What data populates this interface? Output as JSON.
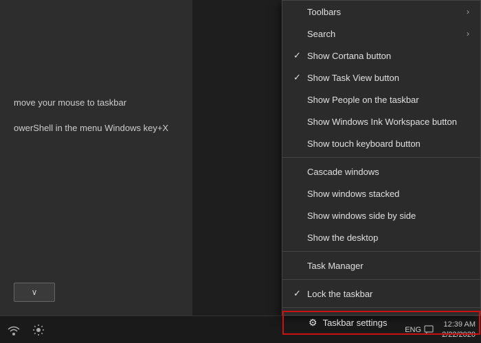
{
  "leftPanel": {
    "text1": "move your mouse to taskbar",
    "text2": "owerShell in the menu Windows key+X"
  },
  "contextMenu": {
    "items": [
      {
        "id": "toolbars",
        "label": "Toolbars",
        "check": "",
        "hasArrow": true,
        "separator_after": false
      },
      {
        "id": "search",
        "label": "Search",
        "check": "",
        "hasArrow": true,
        "separator_after": false
      },
      {
        "id": "show-cortana",
        "label": "Show Cortana button",
        "check": "✓",
        "hasArrow": false,
        "separator_after": false
      },
      {
        "id": "show-task-view",
        "label": "Show Task View button",
        "check": "✓",
        "hasArrow": false,
        "separator_after": false
      },
      {
        "id": "show-people",
        "label": "Show People on the taskbar",
        "check": "",
        "hasArrow": false,
        "separator_after": false
      },
      {
        "id": "show-ink",
        "label": "Show Windows Ink Workspace button",
        "check": "",
        "hasArrow": false,
        "separator_after": false
      },
      {
        "id": "show-keyboard",
        "label": "Show touch keyboard button",
        "check": "",
        "hasArrow": false,
        "separator_after": true
      },
      {
        "id": "cascade",
        "label": "Cascade windows",
        "check": "",
        "hasArrow": false,
        "separator_after": false
      },
      {
        "id": "stacked",
        "label": "Show windows stacked",
        "check": "",
        "hasArrow": false,
        "separator_after": false
      },
      {
        "id": "side-by-side",
        "label": "Show windows side by side",
        "check": "",
        "hasArrow": false,
        "separator_after": false
      },
      {
        "id": "desktop",
        "label": "Show the desktop",
        "check": "",
        "hasArrow": false,
        "separator_after": true
      },
      {
        "id": "task-manager",
        "label": "Task Manager",
        "check": "",
        "hasArrow": false,
        "separator_after": true
      },
      {
        "id": "lock-taskbar",
        "label": "Lock the taskbar",
        "check": "✓",
        "hasArrow": false,
        "separator_after": true
      },
      {
        "id": "taskbar-settings",
        "label": "Taskbar settings",
        "check": "",
        "hasArrow": false,
        "separator_after": false,
        "highlighted": true,
        "hasGear": true
      }
    ]
  },
  "taskbar": {
    "time": "12:39 AM",
    "date": "2/22/2020",
    "lang": "ENG",
    "dropdown_label": "∨"
  }
}
